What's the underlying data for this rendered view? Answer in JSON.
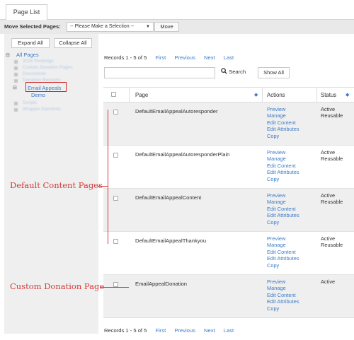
{
  "tab": {
    "label": "Page List"
  },
  "move_bar": {
    "label": "Move Selected Pages:",
    "select_value": "-- Please Make a Selection --",
    "move_button": "Move"
  },
  "sidebar": {
    "expand_all": "Expand All",
    "collapse_all": "Collapse All",
    "root": "All Pages",
    "blurred_items": [
      "2016 Redesign",
      "Custom Donation Pages",
      "Documents",
      "Donation Receipts"
    ],
    "selected_folder": "Email Appeals",
    "child": "Demo",
    "blurred_items_after": [
      "Scripts",
      "Wrapper Elements"
    ]
  },
  "pager": {
    "records": "Records 1 - 5 of 5",
    "first": "First",
    "previous": "Previous",
    "next": "Next",
    "last": "Last"
  },
  "search": {
    "button": "Search",
    "show_all": "Show All"
  },
  "table": {
    "columns": {
      "page": "Page",
      "actions": "Actions",
      "status": "Status"
    },
    "action_labels": [
      "Preview",
      "Manage",
      "Edit Content",
      "Edit Attributes",
      "Copy"
    ],
    "rows": [
      {
        "page": "DefaultEmailAppealAutoresponder",
        "status": [
          "Active",
          "Reusable"
        ]
      },
      {
        "page": "DefaultEmailAppealAutoresponderPlain",
        "status": [
          "Active",
          "Reusable"
        ]
      },
      {
        "page": "DefaultEmailAppealContent",
        "status": [
          "Active",
          "Reusable"
        ]
      },
      {
        "page": "DefaultEmailAppealThankyou",
        "status": [
          "Active",
          "Reusable"
        ]
      },
      {
        "page": "EmailAppealDonation",
        "status": [
          "Active"
        ]
      }
    ]
  },
  "annotations": {
    "default_content": "Default Content Pages",
    "custom_donation": "Custom Donation Page",
    "color": "#d23a3a"
  },
  "colors": {
    "link": "#3b7bc8",
    "row_alt": "#efefef",
    "highlight": "#d02525"
  }
}
